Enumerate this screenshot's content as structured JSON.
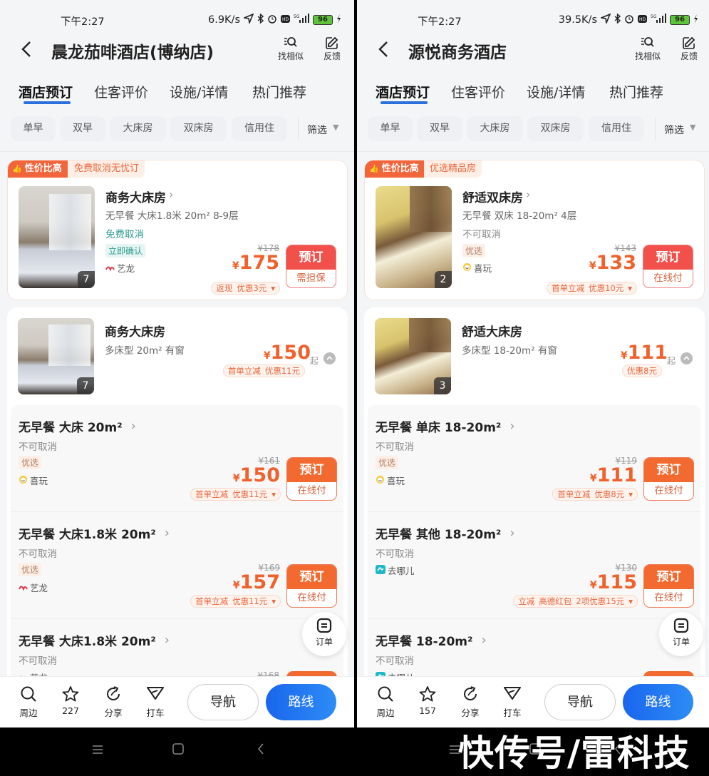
{
  "phones": [
    {
      "status": {
        "time": "下午2:27",
        "speed": "6.9K/s",
        "battery": "96"
      },
      "header": {
        "title": "晨龙茄啡酒店(博纳店)",
        "actions": [
          {
            "label": "找相似",
            "icon": "find-similar-icon"
          },
          {
            "label": "反馈",
            "icon": "feedback-icon"
          }
        ]
      },
      "tabs": [
        {
          "label": "酒店预订",
          "active": true
        },
        {
          "label": "住客评价"
        },
        {
          "label": "设施/详情"
        },
        {
          "label": "热门推荐"
        }
      ],
      "filters": [
        "单早",
        "双早",
        "大床房",
        "双床房",
        "信用住"
      ],
      "filter_more": "筛选",
      "featured": {
        "badge": "性价比高",
        "badge_sub": "免费取消无忧订",
        "name": "商务大床房",
        "specs": "无早餐  大床1.8米  20m²  8-9层",
        "cancel": "免费取消",
        "cancel_free": true,
        "tag": "立即确认",
        "tag_type": "confirm",
        "vendor": "艺龙",
        "vendor_icon": "elong-icon",
        "photo_count": "7",
        "original_price": "¥178",
        "currency": "¥",
        "price": "175",
        "promo": {
          "parts": [
            "返现",
            "优惠3元"
          ],
          "arrow": true
        },
        "book_label": "预订",
        "book_sub": "需担保",
        "photo_style": "grey"
      },
      "group": {
        "name": "商务大床房",
        "specs": "多床型  20m²  有窗",
        "currency": "¥",
        "price": "150",
        "from_label": "起",
        "promo": {
          "parts": [
            "首单立减",
            "优惠11元"
          ],
          "arrow": false
        },
        "photo_count": "7",
        "photo_style": "grey"
      },
      "rates": [
        {
          "name": "无早餐 大床 20m²",
          "cancel": "不可取消",
          "tag": "优选",
          "vendor": "喜玩",
          "vendor_icon": "xiwan-icon",
          "original_price": "¥161",
          "currency": "¥",
          "price": "150",
          "promo": {
            "parts": [
              "首单立减",
              "优惠11元"
            ],
            "arrow": true
          },
          "book_label": "预订",
          "book_sub": "在线付"
        },
        {
          "name": "无早餐 大床1.8米 20m²",
          "cancel": "不可取消",
          "tag": "优选",
          "vendor": "艺龙",
          "vendor_icon": "elong-icon",
          "original_price": "¥169",
          "currency": "¥",
          "price": "157",
          "promo": {
            "parts": [
              "首单立减",
              "优惠11元"
            ],
            "arrow": true
          },
          "book_label": "预订",
          "book_sub": "在线付"
        },
        {
          "name": "无早餐 大床1.8米 20m²",
          "cancel": "不可取消",
          "vendor": "艺龙",
          "vendor_icon": "elong-icon",
          "original_price": "¥168",
          "partial": true
        }
      ],
      "float": {
        "label": "订单"
      },
      "bottom": {
        "items": [
          {
            "label": "周边",
            "icon": "search-icon"
          },
          {
            "label": "227",
            "icon": "star-icon"
          },
          {
            "label": "分享",
            "icon": "share-icon"
          },
          {
            "label": "打车",
            "icon": "taxi-icon"
          }
        ],
        "nav": "导航",
        "route": "路线"
      }
    },
    {
      "status": {
        "time": "下午2:27",
        "speed": "39.5K/s",
        "battery": "96"
      },
      "header": {
        "title": "源悦商务酒店",
        "actions": [
          {
            "label": "找相似",
            "icon": "find-similar-icon"
          },
          {
            "label": "反馈",
            "icon": "feedback-icon"
          }
        ]
      },
      "tabs": [
        {
          "label": "酒店预订",
          "active": true
        },
        {
          "label": "住客评价"
        },
        {
          "label": "设施/详情"
        },
        {
          "label": "热门推荐"
        }
      ],
      "filters": [
        "单早",
        "双早",
        "大床房",
        "双床房",
        "信用住"
      ],
      "filter_more": "筛选",
      "featured": {
        "badge": "性价比高",
        "badge_sub": "优选精品房",
        "name": "舒适双床房",
        "specs": "无早餐  双床  18-20m²  4层",
        "cancel": "不可取消",
        "cancel_free": false,
        "tag": "优选",
        "tag_type": "pref",
        "vendor": "喜玩",
        "vendor_icon": "xiwan-icon",
        "photo_count": "2",
        "original_price": "¥143",
        "currency": "¥",
        "price": "133",
        "promo": {
          "parts": [
            "首单立减",
            "优惠10元"
          ],
          "arrow": true
        },
        "book_label": "预订",
        "book_sub": "在线付",
        "photo_style": "yellow"
      },
      "group": {
        "name": "舒适大床房",
        "specs": "多床型  18-20m²  有窗",
        "currency": "¥",
        "price": "111",
        "from_label": "起",
        "promo": {
          "parts": [
            "优惠8元"
          ],
          "arrow": false
        },
        "photo_count": "3",
        "photo_style": "yellow"
      },
      "rates": [
        {
          "name": "无早餐 单床 18-20m²",
          "cancel": "不可取消",
          "tag": "优选",
          "vendor": "喜玩",
          "vendor_icon": "xiwan-icon",
          "original_price": "¥119",
          "currency": "¥",
          "price": "111",
          "promo": {
            "parts": [
              "首单立减",
              "优惠8元"
            ],
            "arrow": true
          },
          "book_label": "预订",
          "book_sub": "在线付"
        },
        {
          "name": "无早餐 其他 18-20m²",
          "cancel": "不可取消",
          "vendor": "去哪儿",
          "vendor_icon": "qunar-icon",
          "original_price": "¥130",
          "currency": "¥",
          "price": "115",
          "promo": {
            "parts": [
              "立减",
              "高德红包",
              "2项优惠15元"
            ],
            "arrow": true
          },
          "book_label": "预订",
          "book_sub": "在线付"
        },
        {
          "name": "无早餐 18-20m²",
          "cancel": "不可取消",
          "vendor": "去哪儿",
          "vendor_icon": "qunar-icon",
          "partial": true
        }
      ],
      "float": {
        "label": "订单"
      },
      "bottom": {
        "items": [
          {
            "label": "周边",
            "icon": "search-icon"
          },
          {
            "label": "157",
            "icon": "star-icon"
          },
          {
            "label": "分享",
            "icon": "share-icon"
          },
          {
            "label": "打车",
            "icon": "taxi-icon"
          }
        ],
        "nav": "导航",
        "route": "路线"
      }
    }
  ],
  "watermark": "快传号/雷科技",
  "colors": {
    "accent": "#f0612c",
    "route_blue": "#1f6ff0",
    "tab_underline": "#2a6fdb",
    "free_cancel": "#2a9d8f"
  }
}
